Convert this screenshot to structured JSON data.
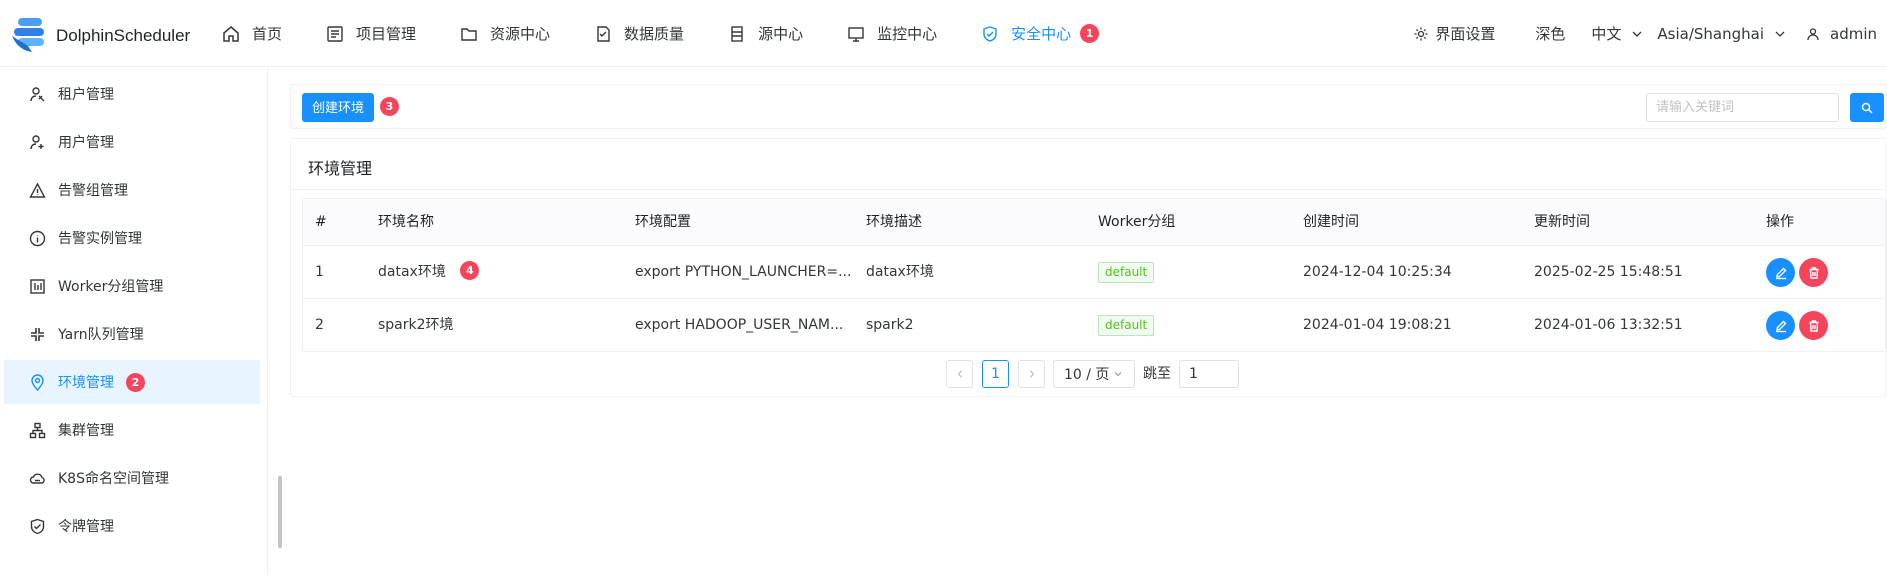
{
  "header": {
    "app_name": "DolphinScheduler",
    "nav": [
      {
        "label": "首页",
        "icon": "home-icon"
      },
      {
        "label": "项目管理",
        "icon": "project-icon"
      },
      {
        "label": "资源中心",
        "icon": "folder-icon"
      },
      {
        "label": "数据质量",
        "icon": "data-quality-icon"
      },
      {
        "label": "源中心",
        "icon": "datasource-icon"
      },
      {
        "label": "监控中心",
        "icon": "monitor-icon"
      },
      {
        "label": "安全中心",
        "icon": "shield-icon",
        "active": true,
        "badge": "1"
      }
    ],
    "settings_label": "界面设置",
    "theme_label": "深色",
    "language": "中文",
    "timezone": "Asia/Shanghai",
    "user": "admin"
  },
  "sidebar": {
    "items": [
      {
        "label": "租户管理",
        "icon": "tenant-icon"
      },
      {
        "label": "用户管理",
        "icon": "user-icon"
      },
      {
        "label": "告警组管理",
        "icon": "warning-icon"
      },
      {
        "label": "告警实例管理",
        "icon": "info-icon"
      },
      {
        "label": "Worker分组管理",
        "icon": "worker-group-icon"
      },
      {
        "label": "Yarn队列管理",
        "icon": "queue-icon"
      },
      {
        "label": "环境管理",
        "icon": "location-icon",
        "active": true,
        "badge": "2"
      },
      {
        "label": "集群管理",
        "icon": "cluster-icon"
      },
      {
        "label": "K8S命名空间管理",
        "icon": "cloud-icon"
      },
      {
        "label": "令牌管理",
        "icon": "token-icon"
      }
    ]
  },
  "toolbar": {
    "create_label": "创建环境",
    "create_badge": "3",
    "search_placeholder": "请输入关键词"
  },
  "card": {
    "title": "环境管理"
  },
  "table": {
    "columns": [
      "#",
      "环境名称",
      "环境配置",
      "环境描述",
      "Worker分组",
      "创建时间",
      "更新时间",
      "操作"
    ],
    "rows": [
      {
        "index": "1",
        "name": "datax环境",
        "name_badge": "4",
        "config": "export PYTHON_LAUNCHER=...",
        "desc": "datax环境",
        "worker_group": "default",
        "created": "2024-12-04 10:25:34",
        "updated": "2025-02-25 15:48:51"
      },
      {
        "index": "2",
        "name": "spark2环境",
        "config": "export HADOOP_USER_NAM...",
        "desc": "spark2",
        "worker_group": "default",
        "created": "2024-01-04 19:08:21",
        "updated": "2024-01-06 13:32:51"
      }
    ]
  },
  "pagination": {
    "current_page": "1",
    "page_size": "10 / 页",
    "jump_label": "跳至",
    "jump_value": "1"
  },
  "colors": {
    "accent": "#1890ff",
    "danger": "#f5455c",
    "success": "#52c41a"
  }
}
